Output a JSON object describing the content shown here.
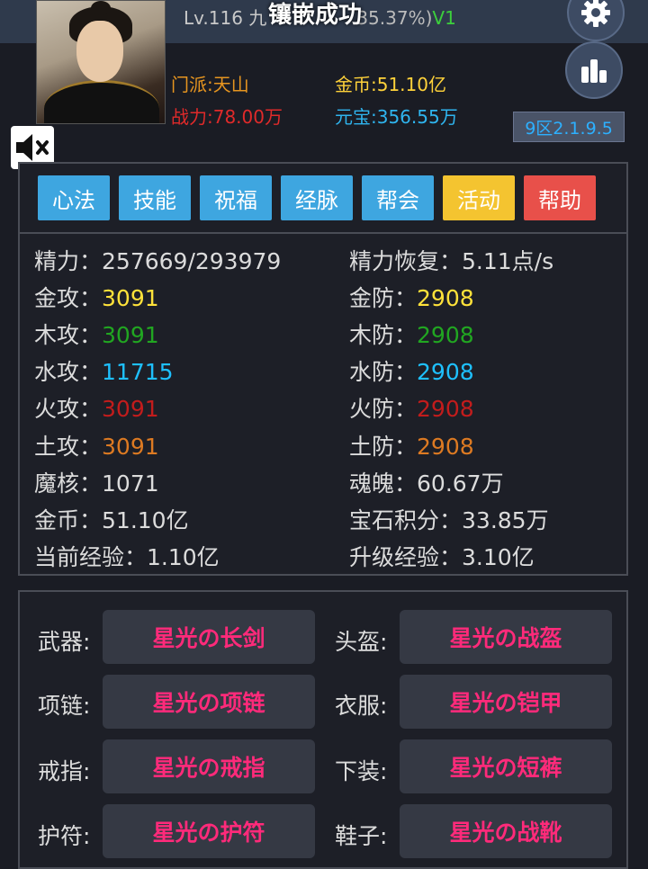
{
  "header": {
    "level_text": "Lv.116 九",
    "progress_text": "35.37%)",
    "vip": "V1",
    "popup": "镶嵌成功",
    "sect": "门派:天山",
    "power": "战力:78.00万",
    "gold": "金币:51.10亿",
    "yuanbao": "元宝:356.55万",
    "server": "9区2.1.9.5"
  },
  "tabs": [
    {
      "label": "心法",
      "color": "blue"
    },
    {
      "label": "技能",
      "color": "blue"
    },
    {
      "label": "祝福",
      "color": "blue"
    },
    {
      "label": "经脉",
      "color": "blue"
    },
    {
      "label": "帮会",
      "color": "blue"
    },
    {
      "label": "活动",
      "color": "gold"
    },
    {
      "label": "帮助",
      "color": "red"
    }
  ],
  "stats": {
    "energy_label": "精力：",
    "energy_value": "257669/293979",
    "energy_regen_label": "精力恢复：",
    "energy_regen_value": "5.11点/s",
    "metal_atk_label": "金攻：",
    "metal_atk_value": "3091",
    "metal_def_label": "金防：",
    "metal_def_value": "2908",
    "wood_atk_label": "木攻：",
    "wood_atk_value": "3091",
    "wood_def_label": "木防：",
    "wood_def_value": "2908",
    "water_atk_label": "水攻：",
    "water_atk_value": "11715",
    "water_def_label": "水防：",
    "water_def_value": "2908",
    "fire_atk_label": "火攻：",
    "fire_atk_value": "3091",
    "fire_def_label": "火防：",
    "fire_def_value": "2908",
    "earth_atk_label": "土攻：",
    "earth_atk_value": "3091",
    "earth_def_label": "土防：",
    "earth_def_value": "2908",
    "core_label": "魔核：",
    "core_value": "1071",
    "soul_label": "魂魄：",
    "soul_value": "60.67万",
    "gold_label": "金币：",
    "gold_value": "51.10亿",
    "gem_label": "宝石积分：",
    "gem_value": "33.85万",
    "exp_label": "当前经验：",
    "exp_value": "1.10亿",
    "levelup_label": "升级经验：",
    "levelup_value": "3.10亿"
  },
  "equipment": {
    "weapon_label": "武器:",
    "weapon": "星光の长剑",
    "helmet_label": "头盔:",
    "helmet": "星光の战盔",
    "necklace_label": "项链:",
    "necklace": "星光の项链",
    "armor_label": "衣服:",
    "armor": "星光の铠甲",
    "ring_label": "戒指:",
    "ring": "星光の戒指",
    "pants_label": "下装:",
    "pants": "星光の短裤",
    "amulet_label": "护符:",
    "amulet": "星光の护符",
    "boots_label": "鞋子:",
    "boots": "星光の战靴"
  },
  "icons": {
    "settings": "gear-icon",
    "ranking": "bar-chart-icon",
    "mute": "speaker-muted-icon"
  }
}
